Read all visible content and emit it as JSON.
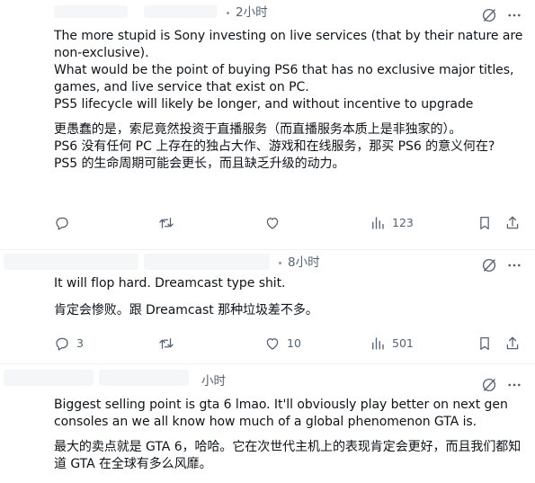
{
  "tweets": [
    {
      "time": "2小时",
      "text_en": "The more stupid is Sony investing on live services (that by their nature are non-exclusive).\nWhat would be the point of buying PS6 that has no exclusive major titles, games, and live service that exist on PC.\nPS5 lifecycle will likely be longer, and without incentive to upgrade",
      "text_zh": "更愚蠢的是，索尼竟然投资于直播服务（而直播服务本质上是非独家的）。\nPS6 没有任何 PC 上存在的独占大作、游戏和在线服务，那买 PS6 的意义何在?\nPS5 的生命周期可能会更长，而且缺乏升级的动力。",
      "replies": "",
      "reposts": "",
      "likes": "",
      "views": "123"
    },
    {
      "time": "8小时",
      "text_en": "It will flop hard. Dreamcast type shit.",
      "text_zh": "肯定会惨败。跟 Dreamcast 那种垃圾差不多。",
      "replies": "3",
      "reposts": "",
      "likes": "10",
      "views": "501"
    },
    {
      "time": "小时",
      "text_en": "Biggest selling point is gta 6 lmao. It'll obviously play better on next gen consoles an we all know how much of a global phenomenon GTA is.",
      "text_zh": "最大的卖点就是 GTA 6，哈哈。它在次世代主机上的表现肯定会更好，而且我们都知道 GTA 在全球有多么风靡。"
    }
  ],
  "icons": {
    "grok": "grok-icon",
    "more": "more-icon",
    "reply": "reply-icon",
    "repost": "repost-icon",
    "like": "like-icon",
    "views": "views-icon",
    "bookmark": "bookmark-icon",
    "share": "share-icon"
  },
  "colors": {
    "text": "#0f1419",
    "muted": "#536471",
    "divider": "#eff3f4"
  }
}
